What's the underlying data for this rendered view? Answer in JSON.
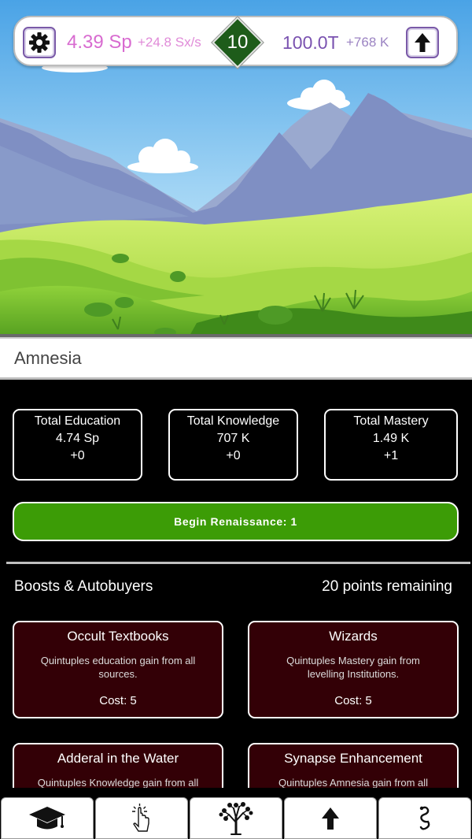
{
  "topbar": {
    "currency_value": "4.39 Sp",
    "currency_rate": "+24.8 Sx/s",
    "level": "10",
    "knowledge_value": "100.0T",
    "knowledge_rate": "+768 K"
  },
  "page_title": "Amnesia",
  "stats": [
    {
      "label": "Total Education",
      "value": "4.74 Sp",
      "delta": "+0"
    },
    {
      "label": "Total Knowledge",
      "value": "707 K",
      "delta": "+0"
    },
    {
      "label": "Total Mastery",
      "value": "1.49 K",
      "delta": "+1"
    }
  ],
  "renaissance_label": "Begin Renaissance: 1",
  "boosts_section": {
    "title": "Boosts & Autobuyers",
    "points_remaining": "20 points remaining"
  },
  "boosts": [
    {
      "name": "Occult Textbooks",
      "description": "Quintuples education gain from all sources.",
      "cost": "Cost: 5"
    },
    {
      "name": "Wizards",
      "description": "Quintuples Mastery gain from levelling Institutions.",
      "cost": "Cost: 5"
    },
    {
      "name": "Adderal in the Water",
      "description": "Quintuples Knowledge gain from all",
      "cost": ""
    },
    {
      "name": "Synapse Enhancement",
      "description": "Quintuples Amnesia gain from all",
      "cost": ""
    }
  ],
  "nav": [
    {
      "icon": "graduation-cap-icon"
    },
    {
      "icon": "pointer-click-icon"
    },
    {
      "icon": "tree-icon"
    },
    {
      "icon": "arrow-up-icon"
    },
    {
      "icon": "snake-icon"
    }
  ],
  "colors": {
    "currency": "#d86bd0",
    "knowledge": "#7a52b0",
    "level_badge": "#1e5c1a",
    "renaissance_button": "#3c9c06",
    "boost_card": "#330006"
  }
}
